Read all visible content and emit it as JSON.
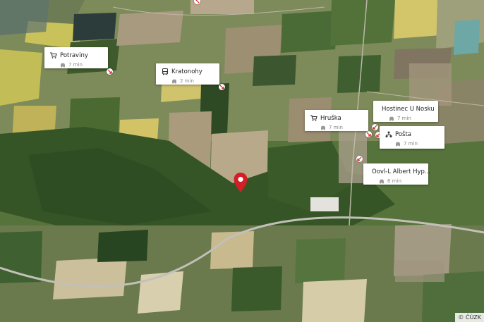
{
  "map": {
    "attribution": "© ČÚZK",
    "accent_color": "#d32027"
  },
  "pois": [
    {
      "name": "Potraviny",
      "eta": "7 min",
      "icon": "cart-icon"
    },
    {
      "name": "Kratonohy",
      "eta": "2 min",
      "icon": "bus-icon"
    },
    {
      "name": "Hruška",
      "eta": "7 min",
      "icon": "cart-icon"
    },
    {
      "name": "Hostinec U Nosku",
      "eta": "7 min",
      "icon": "restaurant-icon"
    },
    {
      "name": "Pošta",
      "eta": "7 min",
      "icon": "post-office-icon"
    },
    {
      "name": "Oovl-L Albert Hyp...",
      "eta": "6 min",
      "icon": "plus-icon"
    }
  ]
}
